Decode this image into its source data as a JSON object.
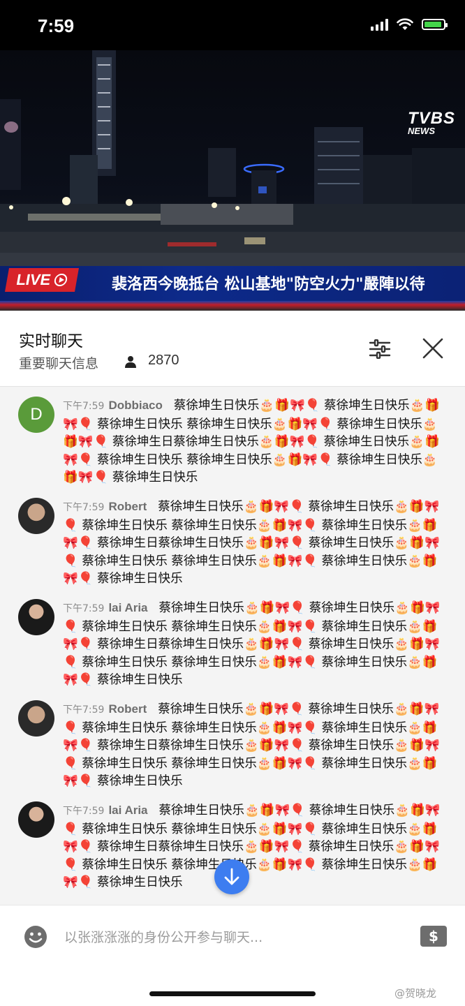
{
  "status_bar": {
    "time": "7:59"
  },
  "video": {
    "channel_logo_top": "TVBS",
    "channel_logo_bottom": "NEWS",
    "live_label": "LIVE",
    "headline": "裴洛西今晚抵台 松山基地\"防空火力\"嚴陣以待"
  },
  "chat_header": {
    "title": "实时聊天",
    "subtitle": "重要聊天信息",
    "viewer_count": "2870"
  },
  "messages": [
    {
      "time": "下午7:59",
      "author": "Dobbiaco",
      "avatar_letter": "D",
      "avatar_color": "#5a9b3a",
      "text": "蔡徐坤生日快乐🎂🎁🎀🎈 蔡徐坤生日快乐🎂🎁🎀🎈 蔡徐坤生日快乐 蔡徐坤生日快乐🎂🎁🎀🎈 蔡徐坤生日快乐🎂🎁🎀🎈 蔡徐坤生日蔡徐坤生日快乐🎂🎁🎀🎈 蔡徐坤生日快乐🎂🎁🎀🎈 蔡徐坤生日快乐 蔡徐坤生日快乐🎂🎁🎀🎈 蔡徐坤生日快乐🎂🎁🎀🎈 蔡徐坤生日快乐"
    },
    {
      "time": "下午7:59",
      "author": "Robert",
      "text": "蔡徐坤生日快乐🎂🎁🎀🎈 蔡徐坤生日快乐🎂🎁🎀🎈 蔡徐坤生日快乐 蔡徐坤生日快乐🎂🎁🎀🎈 蔡徐坤生日快乐🎂🎁🎀🎈 蔡徐坤生日蔡徐坤生日快乐🎂🎁🎀🎈 蔡徐坤生日快乐🎂🎁🎀🎈 蔡徐坤生日快乐 蔡徐坤生日快乐🎂🎁🎀🎈 蔡徐坤生日快乐🎂🎁🎀🎈 蔡徐坤生日快乐"
    },
    {
      "time": "下午7:59",
      "author": "lai Aria",
      "text": "蔡徐坤生日快乐🎂🎁🎀🎈 蔡徐坤生日快乐🎂🎁🎀🎈 蔡徐坤生日快乐 蔡徐坤生日快乐🎂🎁🎀🎈 蔡徐坤生日快乐🎂🎁🎀🎈 蔡徐坤生日蔡徐坤生日快乐🎂🎁🎀🎈 蔡徐坤生日快乐🎂🎁🎀🎈 蔡徐坤生日快乐 蔡徐坤生日快乐🎂🎁🎀🎈 蔡徐坤生日快乐🎂🎁🎀🎈 蔡徐坤生日快乐"
    },
    {
      "time": "下午7:59",
      "author": "Robert",
      "text": "蔡徐坤生日快乐🎂🎁🎀🎈 蔡徐坤生日快乐🎂🎁🎀🎈 蔡徐坤生日快乐 蔡徐坤生日快乐🎂🎁🎀🎈 蔡徐坤生日快乐🎂🎁🎀🎈 蔡徐坤生日蔡徐坤生日快乐🎂🎁🎀🎈 蔡徐坤生日快乐🎂🎁🎀🎈 蔡徐坤生日快乐 蔡徐坤生日快乐🎂🎁🎀🎈 蔡徐坤生日快乐🎂🎁🎀🎈 蔡徐坤生日快乐"
    },
    {
      "time": "下午7:59",
      "author": "lai Aria",
      "text": "蔡徐坤生日快乐🎂🎁🎀🎈 蔡徐坤生日快乐🎂🎁🎀🎈 蔡徐坤生日快乐 蔡徐坤生日快乐🎂🎁🎀🎈 蔡徐坤生日快乐🎂🎁🎀🎈 蔡徐坤生日蔡徐坤生日快乐🎂🎁🎀🎈 蔡徐坤生日快乐🎂🎁🎀🎈 蔡徐坤生日快乐 蔡徐坤生日快乐🎂🎁🎀🎈 蔡徐坤生日快乐🎂🎁🎀🎈 蔡徐坤生日快乐"
    }
  ],
  "input": {
    "placeholder": "以张涨涨涨的身份公开参与聊天..."
  },
  "icons": {
    "filter": "sliders-icon",
    "close": "close-icon",
    "scroll_down": "arrow-down-icon",
    "emoji": "emoji-icon",
    "currency": "currency-icon",
    "person": "person-icon"
  },
  "currency_symbol": "$",
  "watermark": "@贺晓龙",
  "colors": {
    "accent_blue": "#3d7df0",
    "live_red": "#d8232a",
    "banner_blue": "#0d2a8a"
  }
}
